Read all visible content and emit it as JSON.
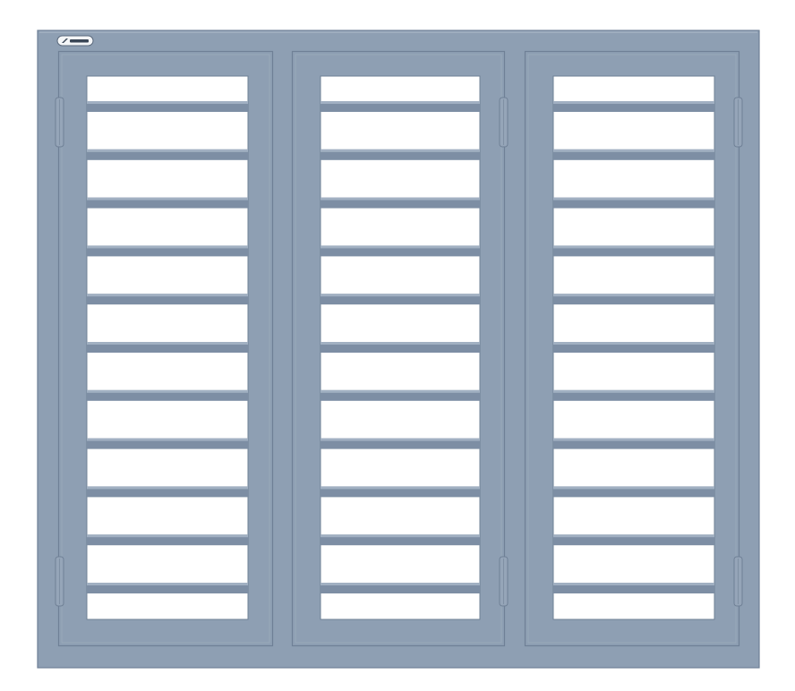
{
  "image": {
    "subject": "steel-window-frame",
    "colors": {
      "background": "#ffffff",
      "frame": "#8e9fb3",
      "frame_light": "#a3b2c3",
      "frame_dark": "#6f8096",
      "bar": "#7d8ea4",
      "bar_highlight": "#b1bfcf",
      "hinge": "#95a5b8",
      "opening": "#ffffff"
    },
    "sashes": [
      {
        "position": "left",
        "hinge_side": "left",
        "bar_count": 11
      },
      {
        "position": "center",
        "hinge_side": "right",
        "bar_count": 11
      },
      {
        "position": "right",
        "hinge_side": "right",
        "bar_count": 11
      }
    ],
    "brand_badge": {
      "icon": "brand-logo-icon"
    }
  }
}
